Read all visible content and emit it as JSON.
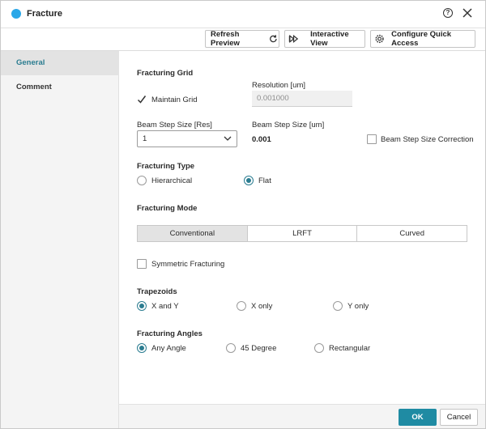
{
  "window": {
    "title": "Fracture",
    "accent_color": "#2aa7e8",
    "help_icon_glyph": "?",
    "icons": [
      "help-icon",
      "close-icon"
    ]
  },
  "toolbar": {
    "refresh_preview": "Refresh Preview",
    "interactive_view": "Interactive View",
    "configure_quick_access": "Configure Quick Access",
    "icons": [
      "refresh-icon",
      "fast-forward-icon",
      "gear-icon"
    ]
  },
  "sidebar": {
    "items": [
      {
        "label": "General",
        "active": true
      },
      {
        "label": "Comment",
        "active": false
      }
    ]
  },
  "grid": {
    "section": "Fracturing Grid",
    "resolution_label": "Resolution [um]",
    "maintain_grid_label": "Maintain Grid",
    "maintain_grid_checked": true,
    "resolution_value": "0.001000",
    "beam_step_res_label": "Beam Step Size [Res]",
    "beam_step_res_value": "1",
    "beam_step_um_label": "Beam Step Size [um]",
    "beam_step_um_value": "0.001",
    "correction_label": "Beam Step Size Correction",
    "correction_checked": false
  },
  "fracturing_type": {
    "section": "Fracturing Type",
    "options": [
      "Hierarchical",
      "Flat"
    ],
    "selected": "Flat"
  },
  "fracturing_mode": {
    "section": "Fracturing Mode",
    "options": [
      "Conventional",
      "LRFT",
      "Curved"
    ],
    "selected": "Conventional"
  },
  "symmetric": {
    "label": "Symmetric Fracturing",
    "checked": false
  },
  "trapezoids": {
    "section": "Trapezoids",
    "options": [
      "X and Y",
      "X only",
      "Y only"
    ],
    "selected": "X and Y"
  },
  "angles": {
    "section": "Fracturing Angles",
    "options": [
      "Any Angle",
      "45 Degree",
      "Rectangular"
    ],
    "selected": "Any Angle"
  },
  "footer": {
    "ok": "OK",
    "cancel": "Cancel",
    "ok_color": "#1f8ba3"
  }
}
